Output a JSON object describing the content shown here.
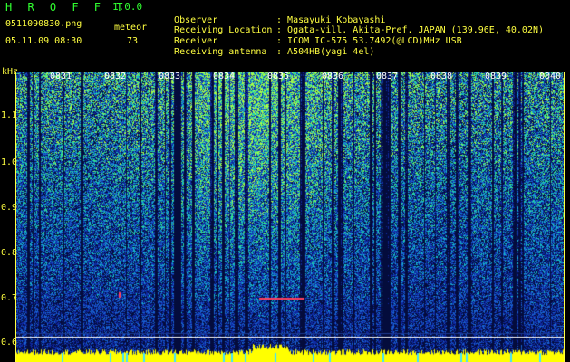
{
  "header": {
    "title": "H R O F F T",
    "version": "1.0.0",
    "filename": "0511090830.png",
    "datetime": "05.11.09 08:30",
    "meteor_label": "meteor",
    "meteor_count": "73"
  },
  "metadata": [
    {
      "key": "Observer",
      "value": "Masayuki Kobayashi"
    },
    {
      "key": "Receiving Location",
      "value": "Ogata-vill. Akita-Pref. JAPAN (139.96E, 40.02N)"
    },
    {
      "key": "Receiver",
      "value": "ICOM IC-575 53.7492(@LCD)MHz USB"
    },
    {
      "key": "Receiving antenna",
      "value": "A504HB(yagi 4el)"
    }
  ],
  "axis": {
    "y_unit": "kHz",
    "y_ticks": [
      "1.1",
      "1.0",
      "0.9",
      "0.8",
      "0.7",
      "0.6"
    ],
    "x_ticks": [
      "0831",
      "0832",
      "0833",
      "0834",
      "0835",
      "0836",
      "0837",
      "0838",
      "0839",
      "0840"
    ]
  },
  "colors": {
    "text_header": "#ffff40",
    "title": "#30ff30",
    "noise_low": "#0a1a80",
    "noise_mid": "#1f6fd0",
    "noise_high": "#20e0c0",
    "signal_hot": "#a0ff40",
    "baseline": "#ffff00",
    "meteor_trace": "#ff4060"
  }
}
